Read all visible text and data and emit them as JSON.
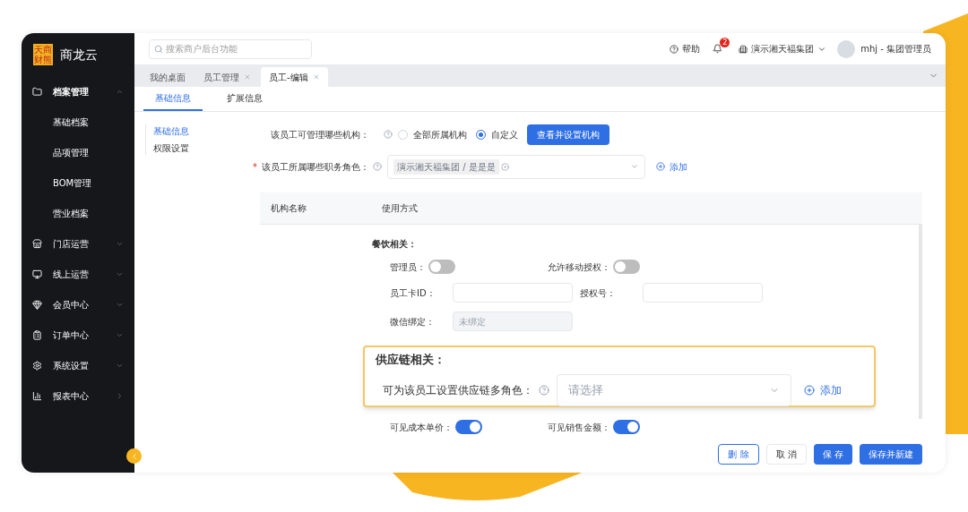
{
  "sidebar": {
    "logo": [
      "天商",
      "财熊"
    ],
    "brand": "商龙云",
    "items": [
      {
        "label": "档案管理",
        "kind": "submenu",
        "expanded": true,
        "children": [
          {
            "label": "基础档案"
          },
          {
            "label": "品项管理"
          },
          {
            "label": "BOM管理"
          },
          {
            "label": "营业档案"
          }
        ]
      },
      {
        "label": "门店运营",
        "kind": "submenu",
        "expanded": false
      },
      {
        "label": "线上运营",
        "kind": "submenu",
        "expanded": false
      },
      {
        "label": "会员中心",
        "kind": "submenu",
        "expanded": false
      },
      {
        "label": "订单中心",
        "kind": "submenu",
        "expanded": false
      },
      {
        "label": "系统设置",
        "kind": "submenu",
        "expanded": false
      },
      {
        "label": "报表中心",
        "kind": "page",
        "expanded": false
      }
    ]
  },
  "header": {
    "search": {
      "placeholder": "搜索商户后台功能"
    },
    "help": "帮助",
    "notifications": "2",
    "org": "演示湘天福集团",
    "user": "mhj - 集团管理员"
  },
  "tabs": [
    {
      "label": "我的桌面",
      "closable": false,
      "selected": false
    },
    {
      "label": "员工管理",
      "closable": true,
      "selected": false
    },
    {
      "label": "员工-编辑",
      "closable": true,
      "selected": true
    }
  ],
  "subtabs": [
    {
      "label": "基础信息",
      "selected": true
    },
    {
      "label": "扩展信息",
      "selected": false
    }
  ],
  "anchors": [
    {
      "label": "基础信息",
      "selected": true
    },
    {
      "label": "权限设置",
      "selected": false
    }
  ],
  "form": {
    "org_scope": {
      "label": "该员工可管理哪些机构：",
      "options": [
        {
          "label": "全部所属机构",
          "selected": false
        },
        {
          "label": "自定义",
          "selected": true
        }
      ],
      "button": "查看并设置机构"
    },
    "roles": {
      "label": "该员工所属哪些职务角色：",
      "required_mark": "*",
      "tags": [
        "演示湘天福集团 / 是是是"
      ],
      "add": "添加"
    },
    "table": {
      "columns": [
        "机构名称",
        "使用方式"
      ]
    },
    "catering": {
      "title": "餐饮相关：",
      "toggles": [
        {
          "label": "管理员：",
          "on": false
        },
        {
          "label": "允许移动授权：",
          "on": false
        }
      ],
      "fields": [
        {
          "label": "员工卡ID：",
          "disabled": false
        },
        {
          "label": "授权号：",
          "disabled": false
        }
      ],
      "wechat": {
        "label": "微信绑定：",
        "value": "未绑定",
        "disabled": true
      }
    },
    "supply": {
      "title": "供应链相关：",
      "label": "可为该员工设置供应链多角色：",
      "placeholder": "请选择",
      "add": "添加"
    },
    "visibility": [
      {
        "label": "可见成本单价：",
        "on": true
      },
      {
        "label": "可见销售金额：",
        "on": true
      }
    ]
  },
  "footer": [
    {
      "label": "删 除",
      "kind": "danger"
    },
    {
      "label": "取 消",
      "kind": "default"
    },
    {
      "label": "保 存",
      "kind": "primary"
    },
    {
      "label": "保存并新建",
      "kind": "primary"
    }
  ]
}
